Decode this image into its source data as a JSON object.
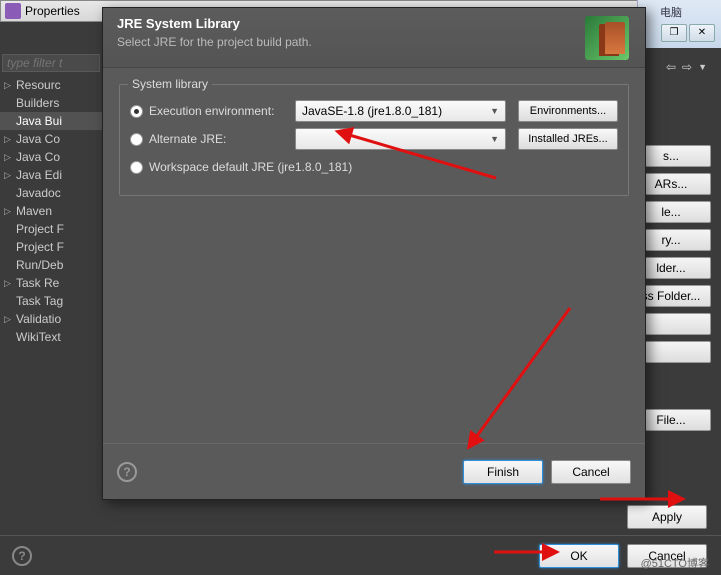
{
  "top_chrome": {
    "label": "电脑"
  },
  "bg": {
    "title": "Properties",
    "filter_placeholder": "type filter t"
  },
  "sidebar": {
    "items": [
      {
        "label": "Resourc",
        "arrow": true
      },
      {
        "label": "Builders",
        "arrow": false
      },
      {
        "label": "Java Bui",
        "arrow": false,
        "selected": true
      },
      {
        "label": "Java Co",
        "arrow": true
      },
      {
        "label": "Java Co",
        "arrow": true
      },
      {
        "label": "Java Edi",
        "arrow": true
      },
      {
        "label": "Javadoc",
        "arrow": false
      },
      {
        "label": "Maven",
        "arrow": true
      },
      {
        "label": "Project F",
        "arrow": false
      },
      {
        "label": "Project F",
        "arrow": false
      },
      {
        "label": "Run/Deb",
        "arrow": false
      },
      {
        "label": "Task Re",
        "arrow": true
      },
      {
        "label": "Task Tag",
        "arrow": false
      },
      {
        "label": "Validatio",
        "arrow": true
      },
      {
        "label": "WikiText",
        "arrow": false
      }
    ]
  },
  "right_buttons": [
    "s...",
    "ARs...",
    "le...",
    "ry...",
    "lder...",
    "ss Folder...",
    "",
    "",
    "File..."
  ],
  "apply_bar": {
    "apply": "Apply"
  },
  "bottom_bar": {
    "ok": "OK",
    "cancel": "Cancel"
  },
  "modal": {
    "title": "JRE System Library",
    "subtitle": "Select JRE for the project build path.",
    "fieldset_legend": "System library",
    "rows": {
      "exec_env": {
        "label": "Execution environment:",
        "value": "JavaSE-1.8 (jre1.8.0_181)",
        "btn": "Environments..."
      },
      "alt_jre": {
        "label": "Alternate JRE:",
        "value": "",
        "btn": "Installed JREs..."
      },
      "workspace": {
        "label": "Workspace default JRE (jre1.8.0_181)"
      }
    },
    "footer": {
      "finish": "Finish",
      "cancel": "Cancel"
    }
  },
  "watermark": "@51CTO博客"
}
